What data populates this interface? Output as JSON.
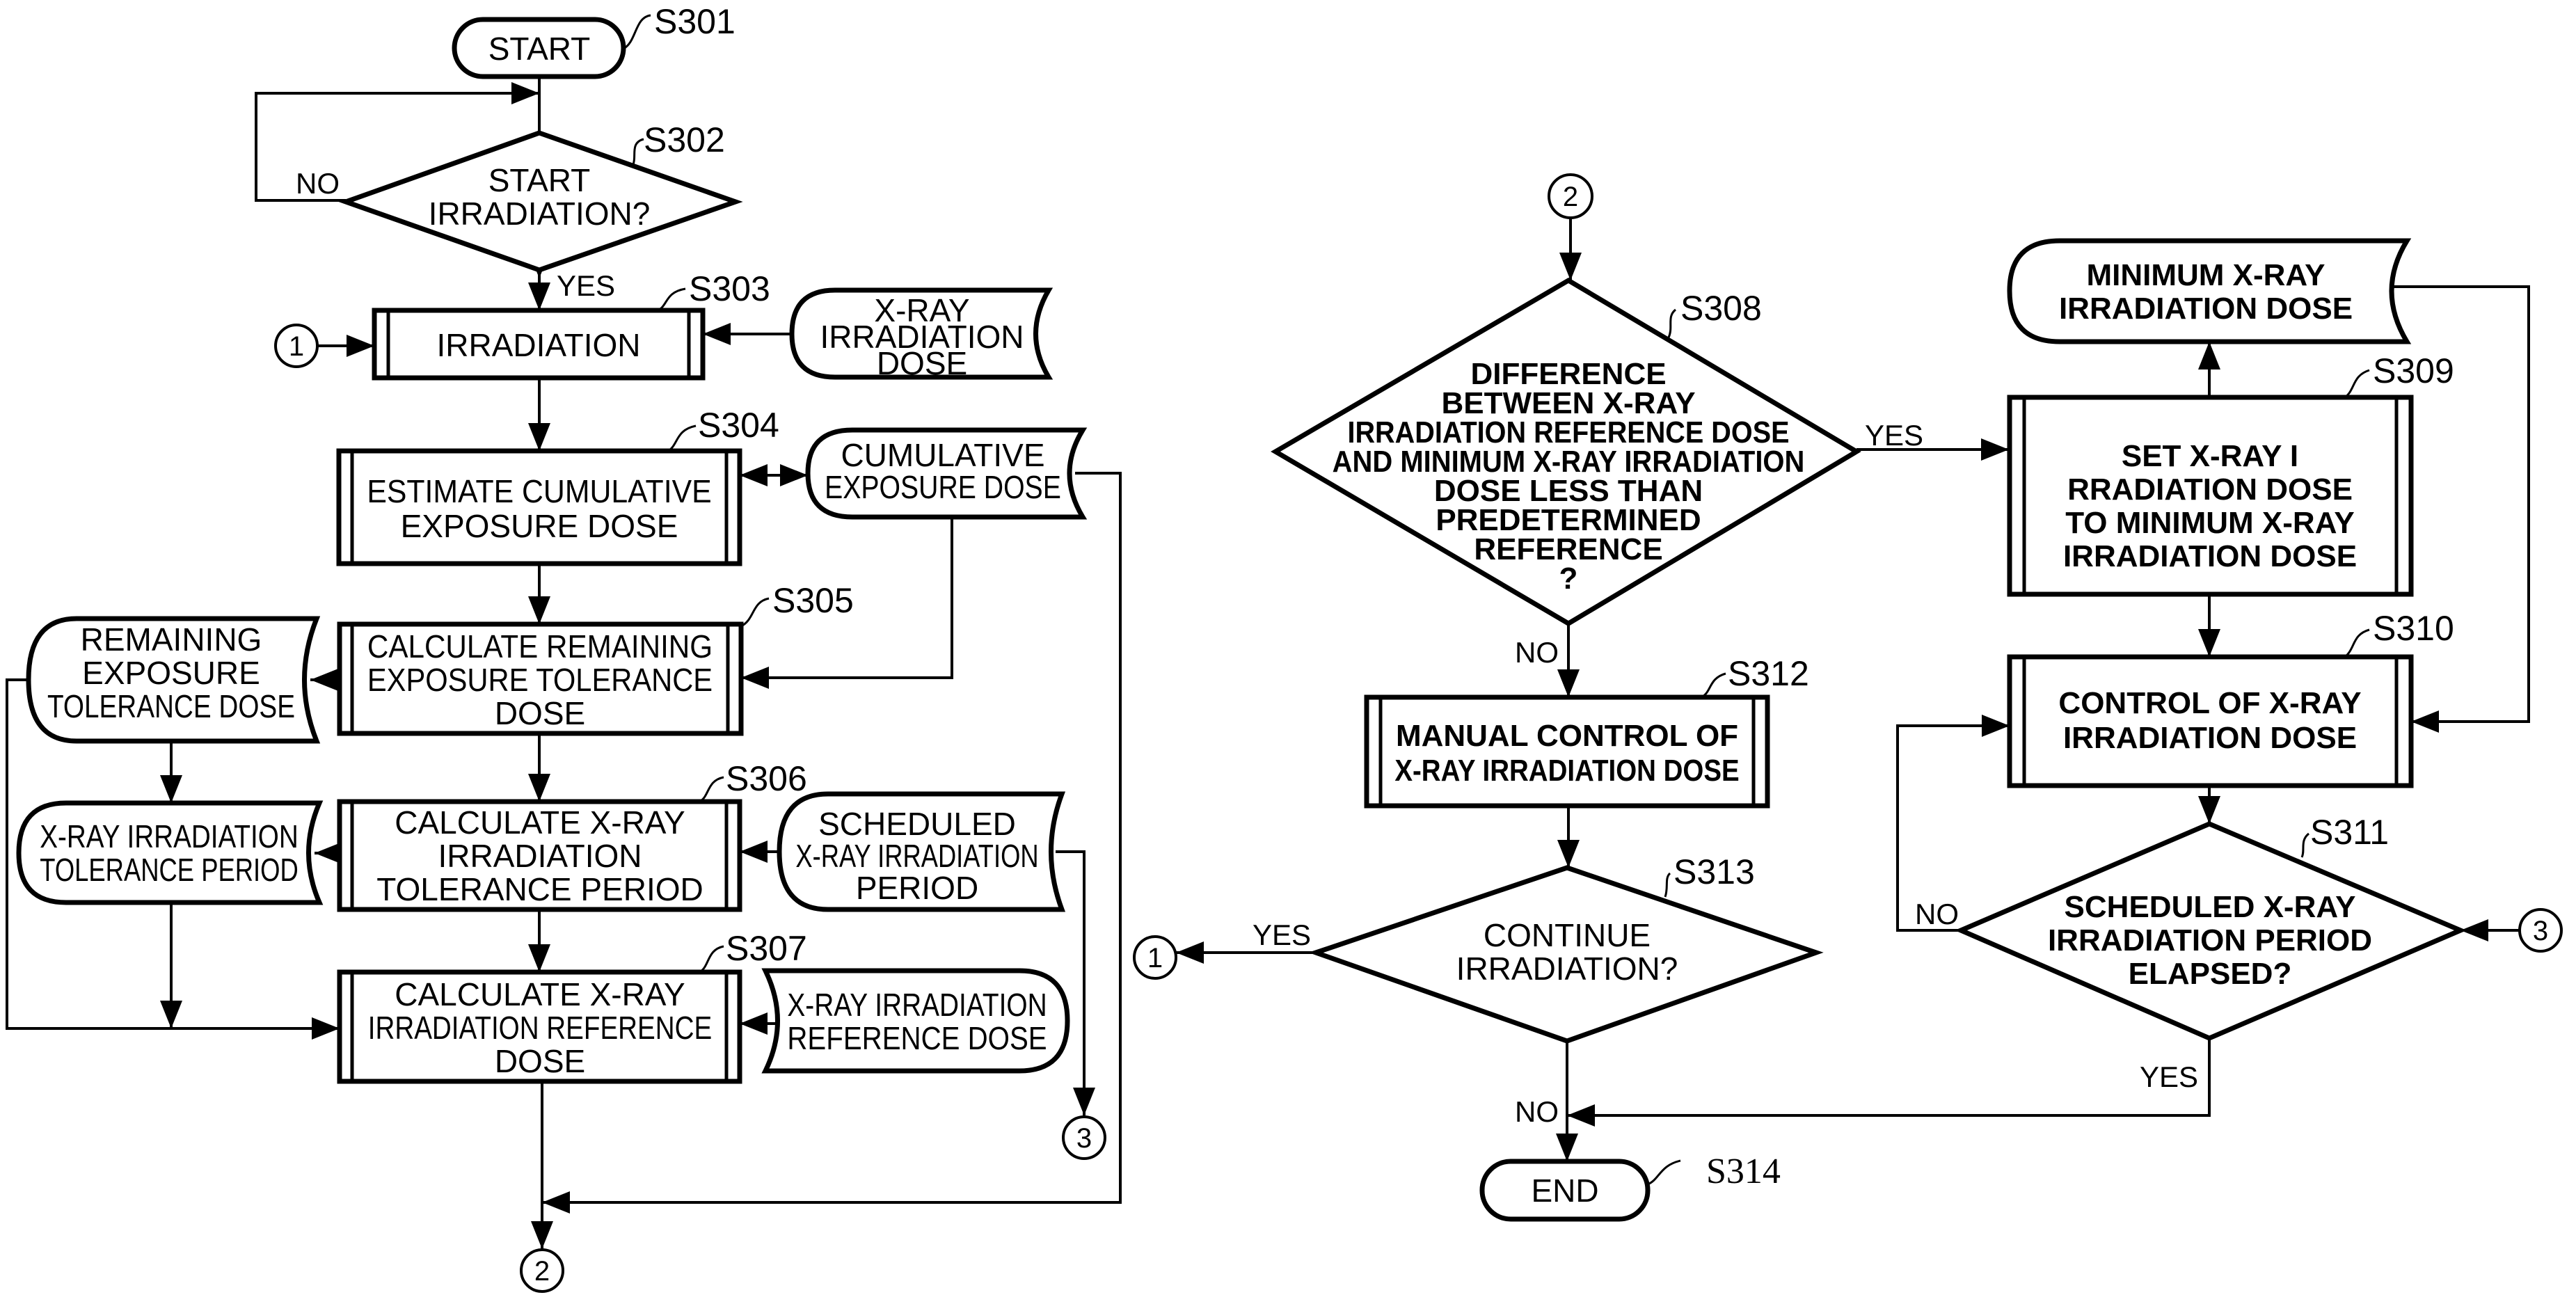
{
  "figure": {
    "steps": {
      "s301": {
        "id": "S301",
        "lines": [
          "START"
        ]
      },
      "s302": {
        "id": "S302",
        "lines": [
          "START",
          "IRRADIATION?"
        ]
      },
      "s303": {
        "id": "S303",
        "lines": [
          "IRRADIATION"
        ]
      },
      "s304": {
        "id": "S304",
        "lines": [
          "ESTIMATE CUMULATIVE",
          "EXPOSURE DOSE"
        ]
      },
      "s305": {
        "id": "S305",
        "lines": [
          "CALCULATE REMAINING",
          "EXPOSURE TOLERANCE",
          "DOSE"
        ]
      },
      "s306": {
        "id": "S306",
        "lines": [
          "CALCULATE X-RAY",
          "IRRADIATION",
          "TOLERANCE PERIOD"
        ]
      },
      "s307": {
        "id": "S307",
        "lines": [
          "CALCULATE X-RAY",
          "IRRADIATION REFERENCE",
          "DOSE"
        ]
      },
      "s308": {
        "id": "S308",
        "lines": [
          "DIFFERENCE",
          "BETWEEN X-RAY",
          "IRRADIATION REFERENCE DOSE",
          "AND MINIMUM X-RAY IRRADIATION",
          "DOSE LESS THAN",
          "PREDETERMINED",
          "REFERENCE",
          "?"
        ]
      },
      "s309": {
        "id": "S309",
        "lines": [
          "SET X-RAY I",
          "RRADIATION DOSE",
          "TO MINIMUM X-RAY",
          "IRRADIATION DOSE"
        ]
      },
      "s310": {
        "id": "S310",
        "lines": [
          "CONTROL OF X-RAY",
          "IRRADIATION DOSE"
        ]
      },
      "s311": {
        "id": "S311",
        "lines": [
          "SCHEDULED X-RAY",
          "IRRADIATION PERIOD",
          "ELAPSED?"
        ]
      },
      "s312": {
        "id": "S312",
        "lines": [
          "MANUAL CONTROL OF",
          "X-RAY IRRADIATION DOSE"
        ]
      },
      "s313": {
        "id": "S313",
        "lines": [
          "CONTINUE",
          "IRRADIATION?"
        ]
      },
      "s314": {
        "id": "S314",
        "lines": [
          "END"
        ]
      }
    },
    "data_stores": {
      "xray_dose": {
        "lines": [
          "X-RAY",
          "IRRADIATION",
          "DOSE"
        ]
      },
      "cumulative": {
        "lines": [
          "CUMULATIVE",
          "EXPOSURE DOSE"
        ]
      },
      "remaining": {
        "lines": [
          "REMAINING",
          "EXPOSURE",
          "TOLERANCE DOSE"
        ]
      },
      "tolerance_period": {
        "lines": [
          "X-RAY IRRADIATION",
          "TOLERANCE PERIOD"
        ]
      },
      "scheduled_period": {
        "lines": [
          "SCHEDULED",
          "X-RAY IRRADIATION",
          "PERIOD"
        ]
      },
      "reference_dose": {
        "lines": [
          "X-RAY IRRADIATION",
          "REFERENCE DOSE"
        ]
      },
      "minimum_dose": {
        "lines": [
          "MINIMUM X-RAY",
          "IRRADIATION DOSE"
        ]
      }
    },
    "branch_labels": {
      "yes": "YES",
      "no": "NO"
    },
    "connectors": {
      "c1": "1",
      "c2": "2",
      "c3": "3"
    }
  }
}
